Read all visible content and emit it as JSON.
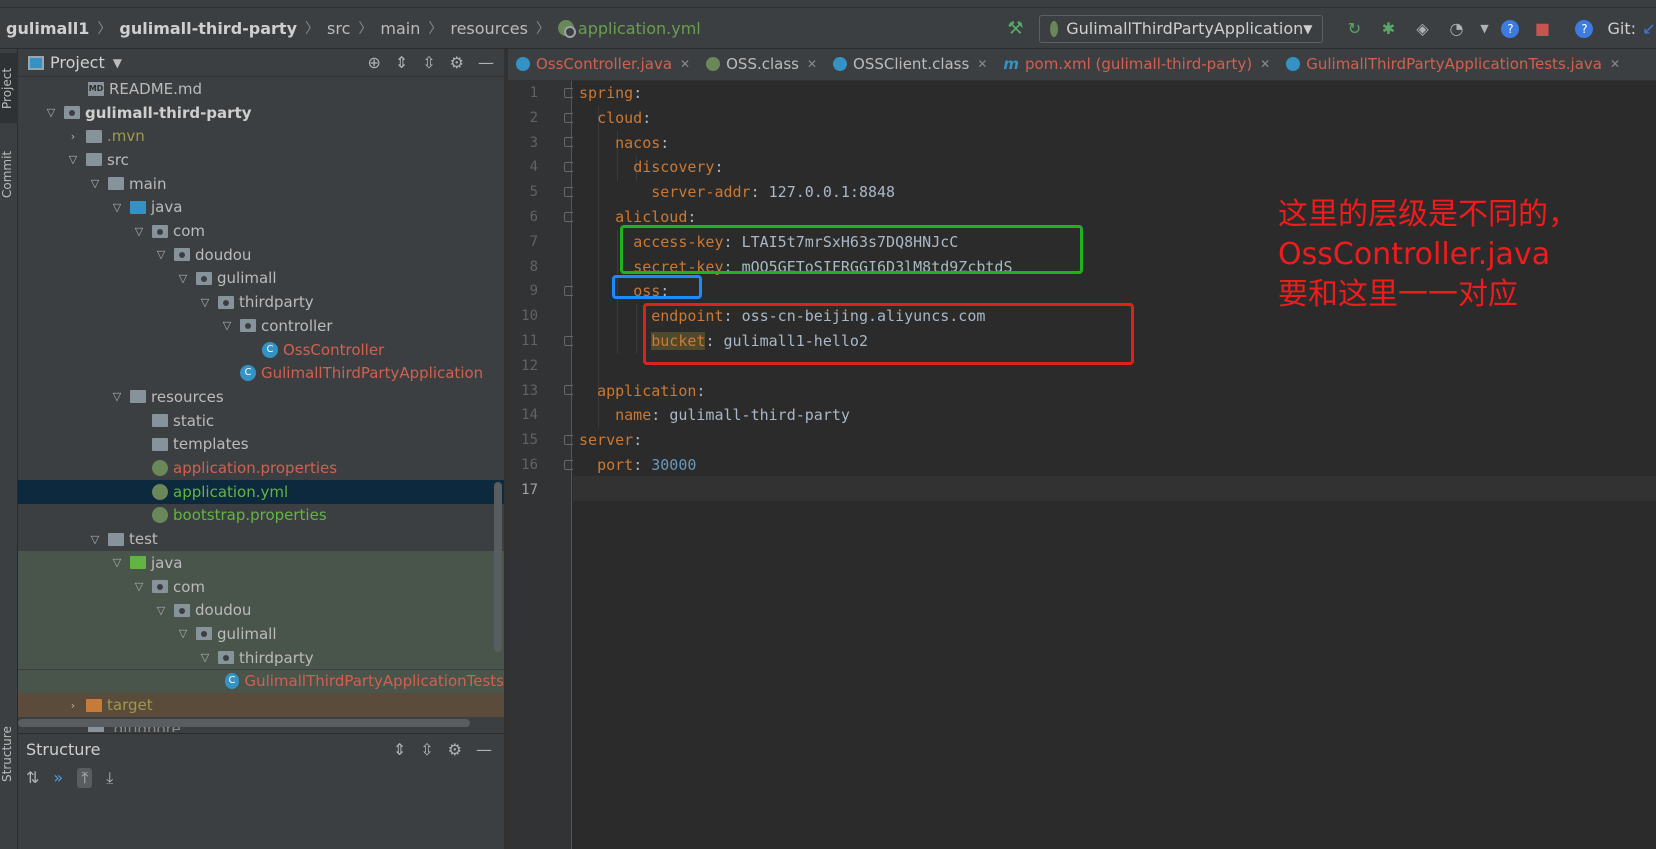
{
  "breadcrumb": {
    "project": "gulimall1",
    "module": "gulimall-third-party",
    "dirs": [
      "src",
      "main",
      "resources"
    ],
    "file": "application.yml"
  },
  "toolbar": {
    "run_configuration": "GulimallThirdPartyApplication",
    "git_label": "Git:"
  },
  "side_tabs": {
    "project": "Project",
    "commit": "Commit",
    "structure": "Structure"
  },
  "project_panel": {
    "title": "Project",
    "tree": [
      {
        "label": "README.md",
        "icon": "markdown-file-icon"
      },
      {
        "label": "gulimall-third-party",
        "icon": "module-folder-icon"
      },
      {
        "label": ".mvn",
        "icon": "folder-icon"
      },
      {
        "label": "src",
        "icon": "folder-icon"
      },
      {
        "label": "main",
        "icon": "folder-icon"
      },
      {
        "label": "java",
        "icon": "source-folder-icon"
      },
      {
        "label": "com",
        "icon": "package-icon"
      },
      {
        "label": "doudou",
        "icon": "package-icon"
      },
      {
        "label": "gulimall",
        "icon": "package-icon"
      },
      {
        "label": "thirdparty",
        "icon": "package-icon"
      },
      {
        "label": "controller",
        "icon": "package-icon"
      },
      {
        "label": "OssController",
        "icon": "class-icon"
      },
      {
        "label": "GulimallThirdPartyApplication",
        "icon": "spring-boot-class-icon"
      },
      {
        "label": "resources",
        "icon": "resources-folder-icon"
      },
      {
        "label": "static",
        "icon": "folder-icon"
      },
      {
        "label": "templates",
        "icon": "folder-icon"
      },
      {
        "label": "application.properties",
        "icon": "spring-config-icon"
      },
      {
        "label": "application.yml",
        "icon": "spring-config-icon"
      },
      {
        "label": "bootstrap.properties",
        "icon": "spring-config-icon"
      },
      {
        "label": "test",
        "icon": "folder-icon"
      },
      {
        "label": "java",
        "icon": "test-source-folder-icon"
      },
      {
        "label": "com",
        "icon": "package-icon"
      },
      {
        "label": "doudou",
        "icon": "package-icon"
      },
      {
        "label": "gulimall",
        "icon": "package-icon"
      },
      {
        "label": "thirdparty",
        "icon": "package-icon"
      },
      {
        "label": "GulimallThirdPartyApplicationTests",
        "icon": "spring-boot-class-icon"
      },
      {
        "label": "target",
        "icon": "excluded-folder-icon"
      },
      {
        "label": ".gitignore",
        "icon": "file-icon"
      }
    ]
  },
  "structure_panel": {
    "title": "Structure"
  },
  "tabs": [
    {
      "label": "OssController.java",
      "color": "#d1604f"
    },
    {
      "label": "OSS.class",
      "color": "#bbbbbb"
    },
    {
      "label": "OSSClient.class",
      "color": "#bbbbbb"
    },
    {
      "label": "pom.xml (gulimall-third-party)",
      "color": "#d1604f"
    },
    {
      "label": "GulimallThirdPartyApplicationTests.java",
      "color": "#d1604f"
    }
  ],
  "editor": {
    "line_numbers": [
      "1",
      "2",
      "3",
      "4",
      "5",
      "6",
      "7",
      "8",
      "9",
      "10",
      "11",
      "12",
      "13",
      "14",
      "15",
      "16",
      "17"
    ],
    "code": {
      "k1": "spring",
      "k2": "cloud",
      "k3": "nacos",
      "k4": "discovery",
      "k5": "server-addr",
      "v5": "127.0.0.1:8848",
      "k6": "alicloud",
      "k7": "access-key",
      "v7": "LTAI5t7mrSxH63s7DQ8HNJcC",
      "k8": "secret-key",
      "v8": "mOQ5GEToSIFRGGI6D3lM8td9ZcbtdS",
      "k9": "oss",
      "k10": "endpoint",
      "v10": "oss-cn-beijing.aliyuncs.com",
      "k11": "bucket",
      "v11": "gulimall1-hello2",
      "k13": "application",
      "k14": "name",
      "v14": "gulimall-third-party",
      "k15": "server",
      "k16": "port",
      "v16": "30000"
    }
  },
  "annotation": {
    "text": "这里的层级是不同的，OssController.java要和这里一一对应"
  },
  "colors": {
    "annotation_red": "#ee1c1c",
    "box_green": "#1db31d",
    "box_blue": "#1a8cff",
    "box_red": "#e0201b",
    "yaml_key": "#cc7832",
    "yaml_value": "#a9b7c6",
    "yaml_number": "#6897bb"
  }
}
